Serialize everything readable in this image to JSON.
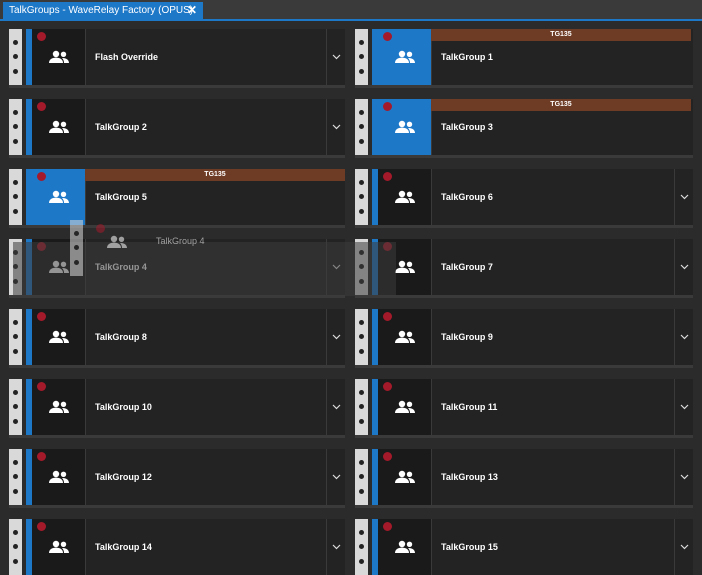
{
  "tab": {
    "title": "TalkGroups - WaveRelay Factory (OPUS)",
    "close_glyph": "✕"
  },
  "colors": {
    "accent": "#1e78c8",
    "banner": "#6e3b25",
    "record": "#a41a2a"
  },
  "tiles": [
    {
      "label": "Flash Override",
      "banner": "",
      "active": false
    },
    {
      "label": "TalkGroup 1",
      "banner": "TG135",
      "active": true
    },
    {
      "label": "TalkGroup 2",
      "banner": "",
      "active": false
    },
    {
      "label": "TalkGroup 3",
      "banner": "TG135",
      "active": true
    },
    {
      "label": "TalkGroup 5",
      "banner": "TG135",
      "active": true
    },
    {
      "label": "TalkGroup 6",
      "banner": "",
      "active": false
    },
    {
      "label": "TalkGroup 4",
      "banner": "",
      "active": false
    },
    {
      "label": "TalkGroup 7",
      "banner": "",
      "active": false
    },
    {
      "label": "TalkGroup 8",
      "banner": "",
      "active": false
    },
    {
      "label": "TalkGroup 9",
      "banner": "",
      "active": false
    },
    {
      "label": "TalkGroup 10",
      "banner": "",
      "active": false
    },
    {
      "label": "TalkGroup 11",
      "banner": "",
      "active": false
    },
    {
      "label": "TalkGroup 12",
      "banner": "",
      "active": false
    },
    {
      "label": "TalkGroup 13",
      "banner": "",
      "active": false
    },
    {
      "label": "TalkGroup 14",
      "banner": "",
      "active": false
    },
    {
      "label": "TalkGroup 15",
      "banner": "",
      "active": false
    }
  ],
  "drag_ghost": {
    "label": "TalkGroup 4"
  },
  "icons": {
    "group": "users-icon",
    "expand": "chevron-down-icon",
    "record": "record-indicator"
  }
}
